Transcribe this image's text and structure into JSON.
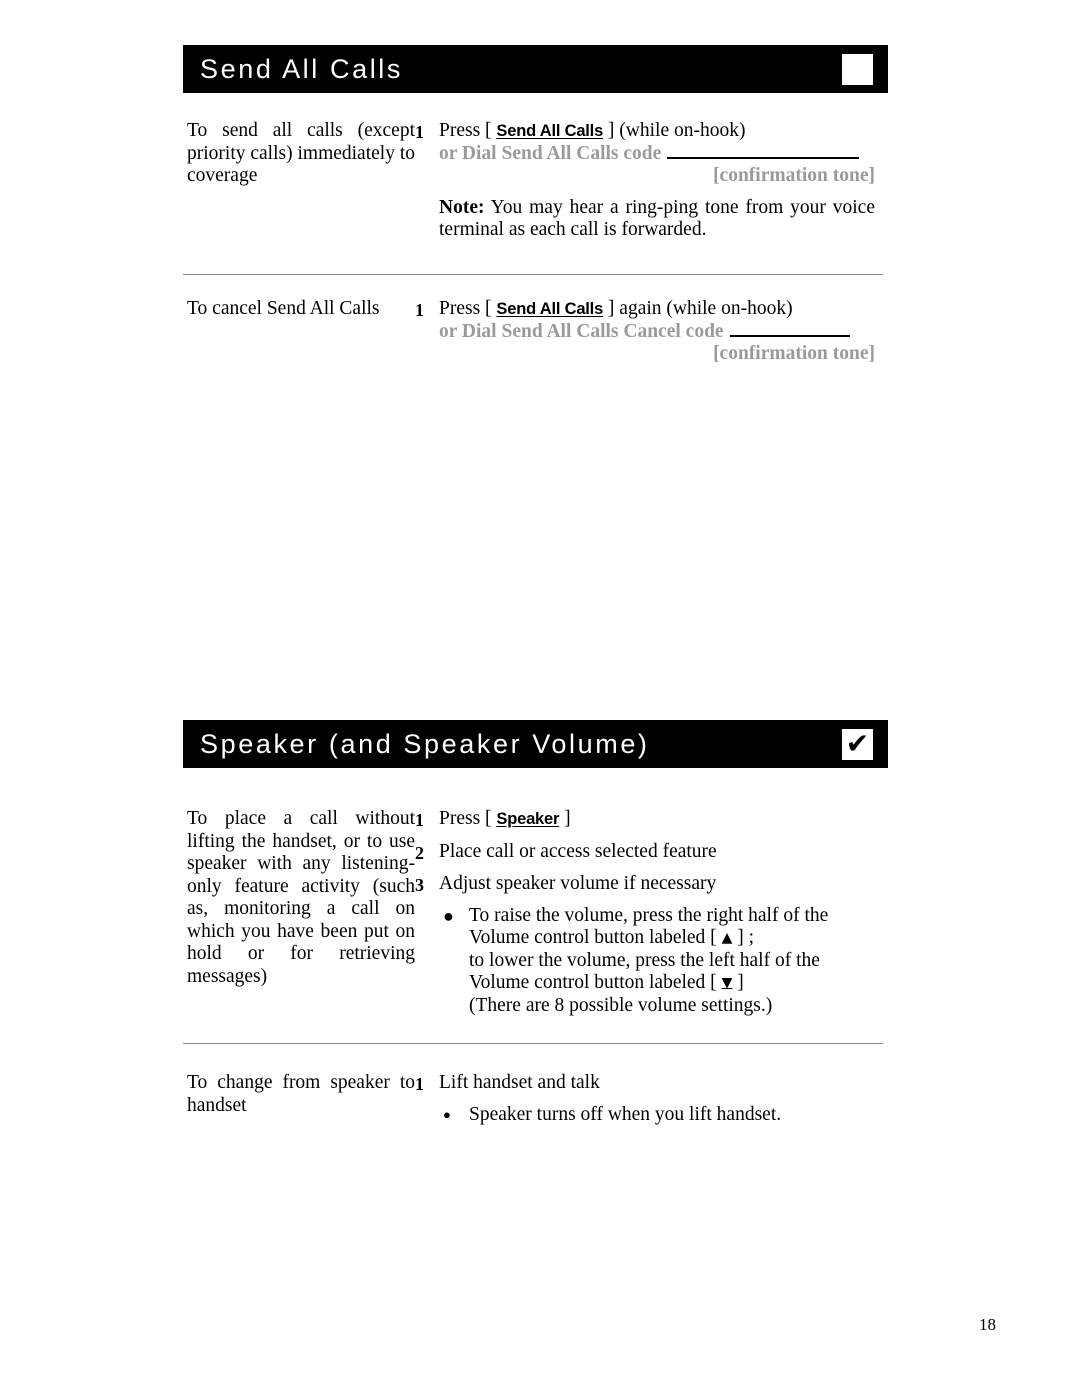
{
  "page": {
    "number": "18"
  },
  "sections": [
    {
      "id": "send-all-calls",
      "title": "Send All Calls",
      "header_icon": "empty-checkbox-icon",
      "header_icon_glyph": "",
      "blocks": [
        {
          "id": "send-all-calls-activate",
          "left_text": "To send all calls (except priority calls) immediately to coverage",
          "step_number": "1",
          "press_prefix": "Press [ ",
          "button_label": "Send All Calls",
          "press_suffix": " ] (while on-hook)",
          "dial_line": "or Dial Send All Calls code",
          "blank_rule": "rule-long",
          "confirmation": "[confirmation  tone]",
          "note_label": "Note:",
          "note_text": " You may hear a ring-ping tone from your voice terminal as each call is forwarded."
        },
        {
          "id": "send-all-calls-cancel",
          "left_text": "To cancel Send All Calls",
          "step_number": "1",
          "press_prefix": "Press [ ",
          "button_label": "Send All Calls",
          "press_suffix": " ] again (while on-hook)",
          "dial_line": "or Dial Send All Calls Cancel code",
          "blank_rule": "rule-short",
          "confirmation": "[confirmation  tone]"
        }
      ]
    },
    {
      "id": "speaker-and-speaker-volume",
      "title": "Speaker (and Speaker Volume)",
      "header_icon": "checked-checkbox-icon",
      "header_icon_glyph": "✔",
      "blocks": [
        {
          "id": "speaker-place-call",
          "left_text": "To place a call without lifting the handset, or to use speaker with any listening-only feature activity (such as, monitoring a call on which you have been put on hold or for retrieving messages)",
          "step1_number": "1",
          "step1_prefix": "Press [ ",
          "step1_button": "Speaker",
          "step1_suffix": " ]",
          "step2_number": "2",
          "step2_text": "Place call or access selected feature",
          "step3_number": "3",
          "step3_text": "Adjust speaker volume if necessary",
          "bullet_line1": "To raise the volume, press the right half of the",
          "bullet_line2_pre": "Volume  control  button  labeled  [ ",
          "bullet_line2_arrow": "▲",
          "bullet_line2_post": " ] ;",
          "bullet_line3": "to lower the volume, press the left half of the",
          "bullet_line4_pre": "Volume  control  button  labeled  [ ",
          "bullet_line4_arrow": "▼",
          "bullet_line4_post": " ]",
          "bullet_line5": "(There are 8 possible volume settings.)"
        },
        {
          "id": "speaker-to-handset",
          "left_text": "To change from speaker to handset",
          "step_number": "1",
          "step_text": "Lift handset and talk",
          "bullet_text": "Speaker turns off when you lift handset."
        }
      ]
    }
  ]
}
